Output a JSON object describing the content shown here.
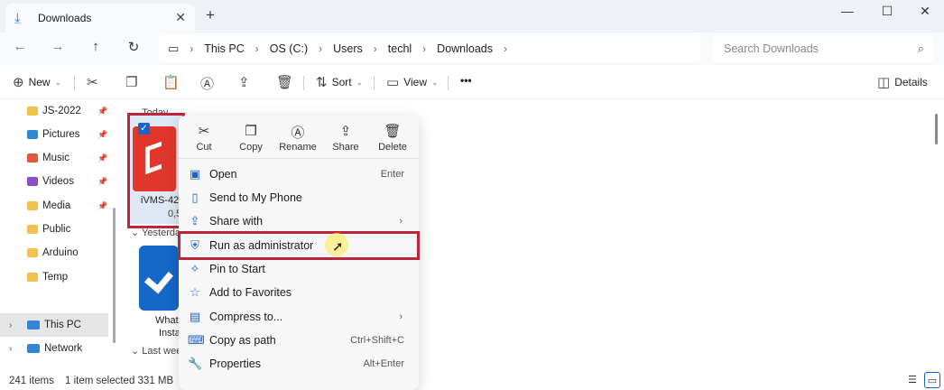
{
  "window": {
    "tab_title": "Downloads",
    "tab_close": "✕",
    "new_tab": "+",
    "minimize": "—",
    "maximize": "☐",
    "close": "✕"
  },
  "nav": {
    "back": "←",
    "forward": "→",
    "up": "↑",
    "refresh": "↻"
  },
  "breadcrumb": [
    "This PC",
    "OS (C:)",
    "Users",
    "techl",
    "Downloads"
  ],
  "search": {
    "placeholder": "Search Downloads"
  },
  "toolbar": {
    "new_label": "New",
    "sort_label": "Sort",
    "view_label": "View",
    "more_label": "•••",
    "details_label": "Details"
  },
  "sidebar": {
    "items": [
      {
        "label": "JS-2022",
        "icon": "folder-icon",
        "color": "#f2c04c",
        "pinned": true
      },
      {
        "label": "Pictures",
        "icon": "pictures-icon",
        "color": "#2f86d6",
        "pinned": true
      },
      {
        "label": "Music",
        "icon": "music-icon",
        "color": "#e0583b",
        "pinned": true
      },
      {
        "label": "Videos",
        "icon": "videos-icon",
        "color": "#8b4fc9",
        "pinned": true
      },
      {
        "label": "Media",
        "icon": "folder-icon",
        "color": "#f2c04c",
        "pinned": true
      },
      {
        "label": "Public",
        "icon": "folder-icon",
        "color": "#f2c04c",
        "pinned": false
      },
      {
        "label": "Arduino",
        "icon": "folder-icon",
        "color": "#f2c04c",
        "pinned": false
      },
      {
        "label": "Temp",
        "icon": "folder-icon",
        "color": "#f2c04c",
        "pinned": false
      },
      {
        "label": "This PC",
        "icon": "this-pc-icon",
        "color": "#2f86d6",
        "pinned": false
      },
      {
        "label": "Network",
        "icon": "network-icon",
        "color": "#2f86d6",
        "pinned": false
      }
    ]
  },
  "groups": {
    "today": "Today",
    "yesterday": "Yesterda",
    "last_week": "Last wee"
  },
  "files": {
    "selected_name": "iVMS-42",
    "selected_size": "0,5",
    "second_name_line1": "What",
    "second_name_line2": "Insta"
  },
  "context_menu": {
    "quick": [
      {
        "label": "Cut",
        "icon": "scissors-icon"
      },
      {
        "label": "Copy",
        "icon": "copy-icon"
      },
      {
        "label": "Rename",
        "icon": "rename-icon"
      },
      {
        "label": "Share",
        "icon": "share-icon"
      },
      {
        "label": "Delete",
        "icon": "trash-icon"
      }
    ],
    "items": [
      {
        "label": "Open",
        "shortcut": "Enter",
        "icon": "open-icon"
      },
      {
        "label": "Send to My Phone",
        "shortcut": "",
        "icon": "phone-icon"
      },
      {
        "label": "Share with",
        "shortcut": "",
        "icon": "share-with-icon",
        "submenu": true
      },
      {
        "label": "Run as administrator",
        "shortcut": "",
        "icon": "shield-icon",
        "highlighted": true
      },
      {
        "label": "Pin to Start",
        "shortcut": "",
        "icon": "pin-icon"
      },
      {
        "label": "Add to Favorites",
        "shortcut": "",
        "icon": "star-icon"
      },
      {
        "label": "Compress to...",
        "shortcut": "",
        "icon": "compress-icon",
        "submenu": true
      },
      {
        "label": "Copy as path",
        "shortcut": "Ctrl+Shift+C",
        "icon": "copy-path-icon"
      },
      {
        "label": "Properties",
        "shortcut": "Alt+Enter",
        "icon": "properties-icon"
      }
    ]
  },
  "status": {
    "items_count": "241 items",
    "selected_info": "1 item selected  331 MB"
  },
  "colors": {
    "accent": "#1a63c7",
    "highlight_box": "#c0243b"
  }
}
